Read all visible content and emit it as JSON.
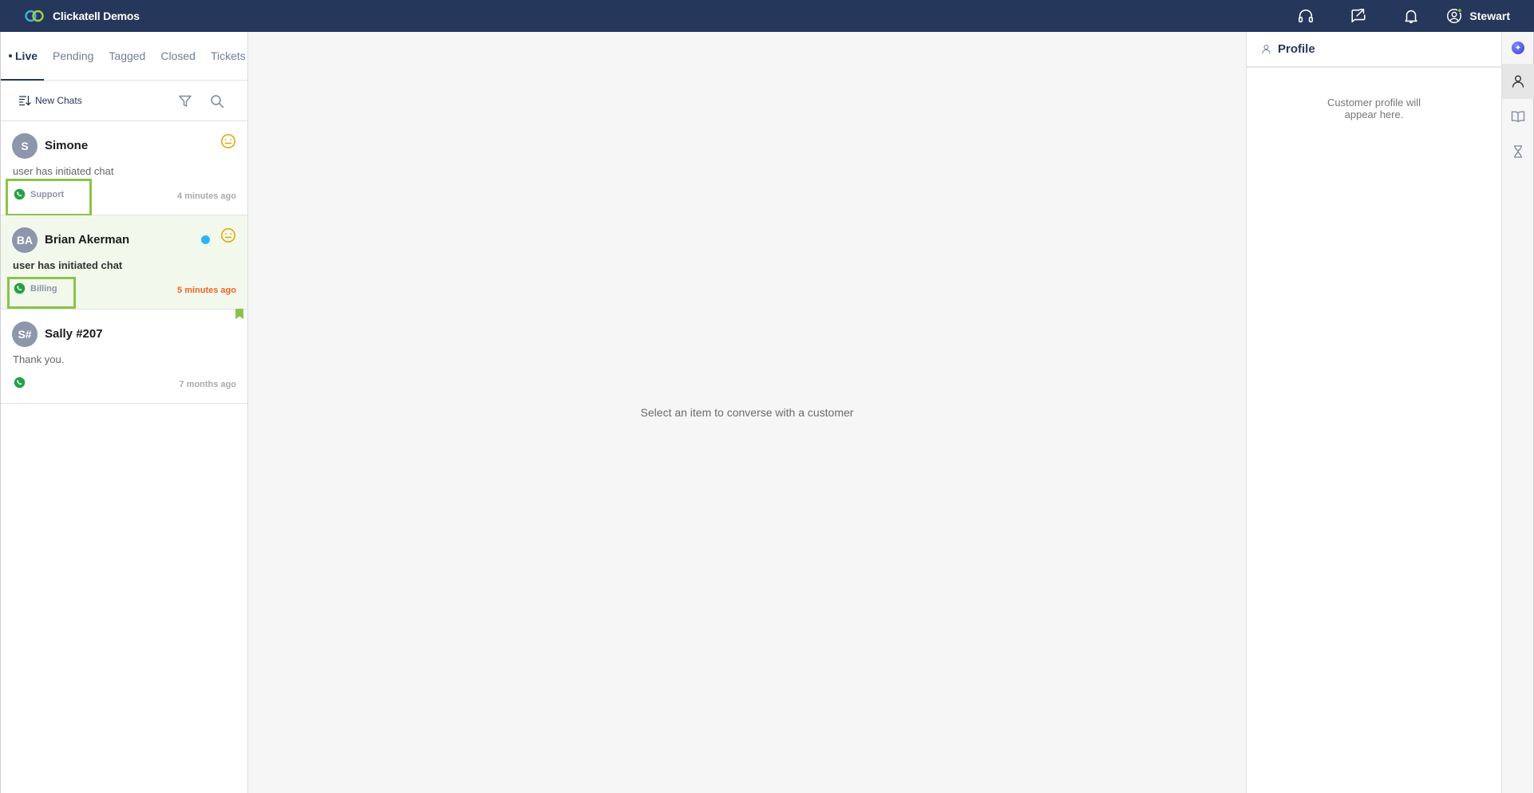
{
  "app": {
    "title": "Clickatell Demos"
  },
  "topbar": {
    "user_name": "Stewart"
  },
  "tabs": [
    "Live",
    "Pending",
    "Tagged",
    "Closed",
    "Tickets"
  ],
  "toolbar": {
    "sort_label": "New Chats"
  },
  "chats": [
    {
      "initials": "S",
      "name": "Simone",
      "message": "user has initiated chat",
      "channel": "Support",
      "time": "4 minutes ago"
    },
    {
      "initials": "BA",
      "name": "Brian Akerman",
      "message": "user has initiated chat",
      "channel": "Billing",
      "time": "5 minutes ago"
    },
    {
      "initials": "S#",
      "name": "Sally #207",
      "message": "Thank you.",
      "channel": "",
      "time": "7 months ago"
    }
  ],
  "center": {
    "empty_message": "Select an item to converse with a customer"
  },
  "profile": {
    "title": "Profile",
    "empty_message": "Customer profile will appear here."
  },
  "colors": {
    "topbar": "#25375a",
    "highlight": "#8bc34a",
    "urgent_time": "#f26522",
    "whatsapp": "#25a244",
    "unread_dot": "#29b6f6"
  }
}
